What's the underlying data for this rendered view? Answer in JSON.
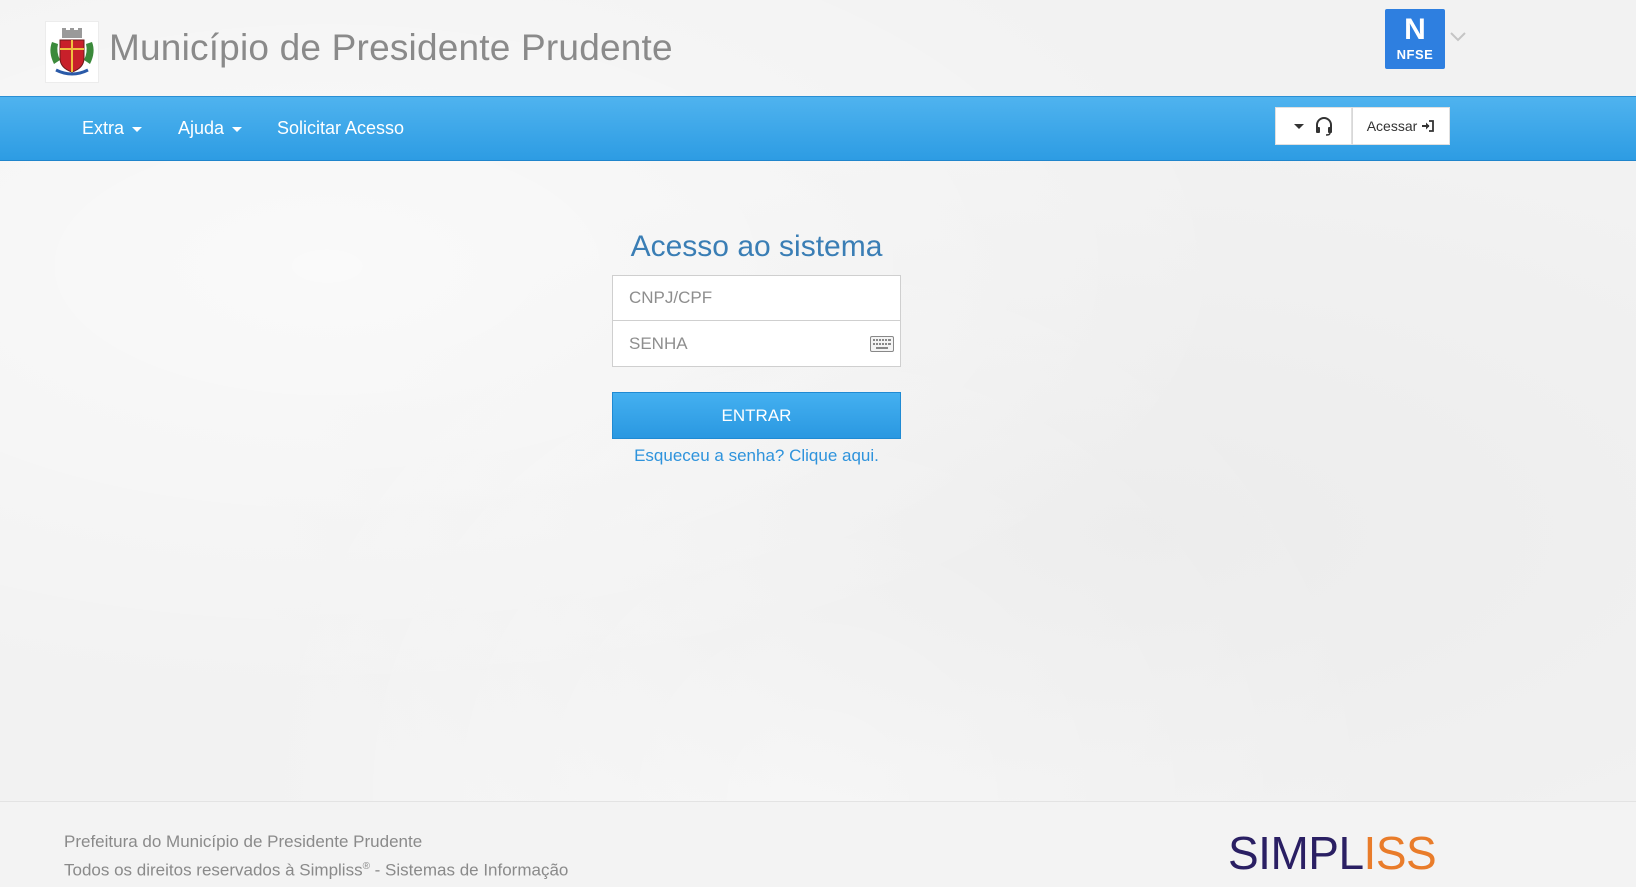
{
  "header": {
    "title": "Município de Presidente Prudente",
    "nfse_logo": {
      "letter": "N",
      "text": "NFSE"
    }
  },
  "navbar": {
    "items": [
      {
        "label": "Extra"
      },
      {
        "label": "Ajuda"
      },
      {
        "label": "Solicitar Acesso"
      }
    ],
    "login_button": "Acessar"
  },
  "login": {
    "title": "Acesso ao sistema",
    "username_placeholder": "CNPJ/CPF",
    "password_placeholder": "SENHA",
    "submit_label": "ENTRAR",
    "forgot_link": "Esqueceu a senha? Clique aqui."
  },
  "footer": {
    "line1": "Prefeitura do Município de Presidente Prudente",
    "line2_prefix": "Todos os direitos reservados à Simpliss",
    "line2_reg": "®",
    "line2_suffix": " - Sistemas de Informação",
    "logo_part1": "SIMPL",
    "logo_part2": "ISS"
  },
  "colors": {
    "navbar": "#2d9ce3",
    "accent": "#3a7eb5",
    "nfse": "#2e7fe0",
    "simpliss_dark": "#2a1f63",
    "simpliss_orange": "#e97c2a"
  }
}
